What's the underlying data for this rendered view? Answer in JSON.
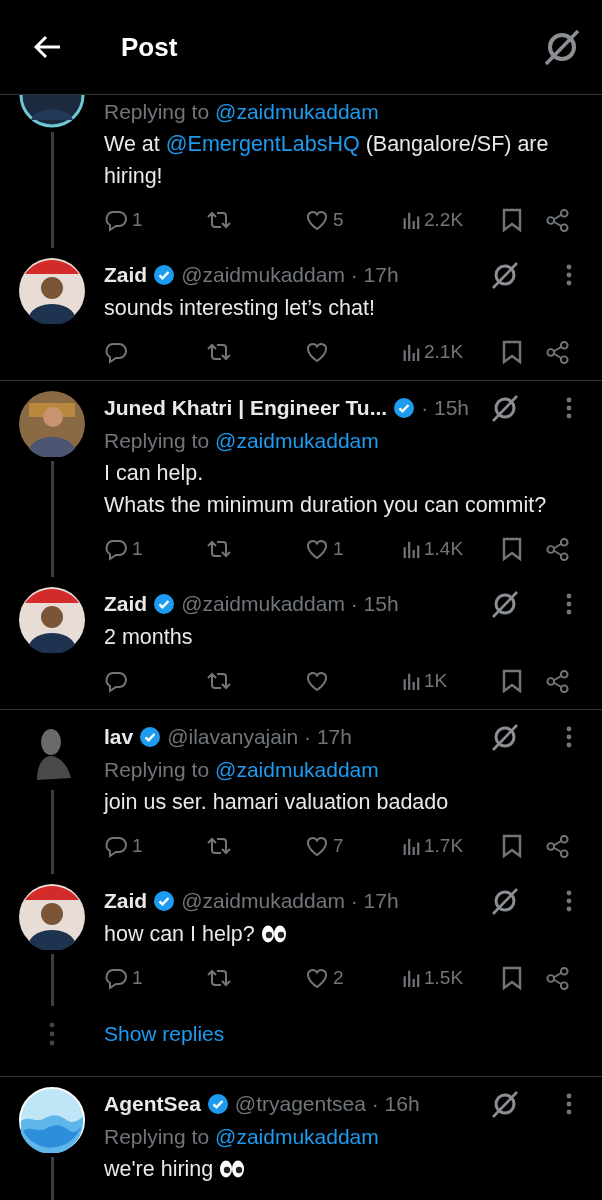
{
  "header": {
    "title": "Post"
  },
  "threads": [
    {
      "continues": false,
      "tweets": [
        {
          "avatar": {
            "kind": "ring"
          },
          "replying_to": "Replying to",
          "mention": "@zaidmukaddam",
          "text": [
            {
              "kind": "plain",
              "text": "We at "
            },
            {
              "kind": "mention",
              "text": "@EmergentLabsHQ"
            },
            {
              "kind": "plain",
              "text": " (Bangalore/SF) are hiring!"
            }
          ],
          "replies": "1",
          "likes": "5",
          "views": "2.2K"
        },
        {
          "avatar": {
            "kind": "red"
          },
          "name": "Zaid",
          "verified": true,
          "handle": "@zaidmukaddam · 17h",
          "text": [
            {
              "kind": "plain",
              "text": "sounds interesting let’s chat!"
            }
          ],
          "views": "2.1K"
        }
      ]
    },
    {
      "continues": false,
      "tweets": [
        {
          "avatar": {
            "kind": "warm"
          },
          "name": "Juned Khatri | Engineer Tu...",
          "verified": true,
          "handle": "· 15h",
          "replying_to": "Replying to",
          "mention": "@zaidmukaddam",
          "text": [
            {
              "kind": "plain",
              "text": "I can help.\nWhats the minimum duration you can commit?"
            }
          ],
          "replies": "1",
          "likes": "1",
          "views": "1.4K"
        },
        {
          "avatar": {
            "kind": "red"
          },
          "name": "Zaid",
          "verified": true,
          "handle": "@zaidmukaddam · 15h",
          "text": [
            {
              "kind": "plain",
              "text": "2 months"
            }
          ],
          "views": "1K"
        }
      ]
    },
    {
      "continues": false,
      "show_replies": "Show replies",
      "tweets": [
        {
          "avatar": {
            "kind": "bust"
          },
          "name": "lav",
          "verified": true,
          "handle": "@ilavanyajain · 17h",
          "replying_to": "Replying to",
          "mention": "@zaidmukaddam",
          "text": [
            {
              "kind": "plain",
              "text": "join us ser. hamari valuation badado"
            }
          ],
          "replies": "1",
          "likes": "7",
          "views": "1.7K"
        },
        {
          "avatar": {
            "kind": "red"
          },
          "name": "Zaid",
          "verified": true,
          "handle": "@zaidmukaddam · 17h",
          "text": [
            {
              "kind": "plain",
              "text": "how can I help? "
            },
            {
              "kind": "emoji"
            }
          ],
          "replies": "1",
          "likes": "2",
          "views": "1.5K"
        }
      ]
    },
    {
      "continues": true,
      "tweets": [
        {
          "avatar": {
            "kind": "waves"
          },
          "name": "AgentSea",
          "verified": true,
          "handle": "@tryagentsea · 16h",
          "replying_to": "Replying to",
          "mention": "@zaidmukaddam",
          "text": [
            {
              "kind": "plain",
              "text": "we're hiring "
            },
            {
              "kind": "emoji"
            }
          ]
        }
      ]
    }
  ]
}
